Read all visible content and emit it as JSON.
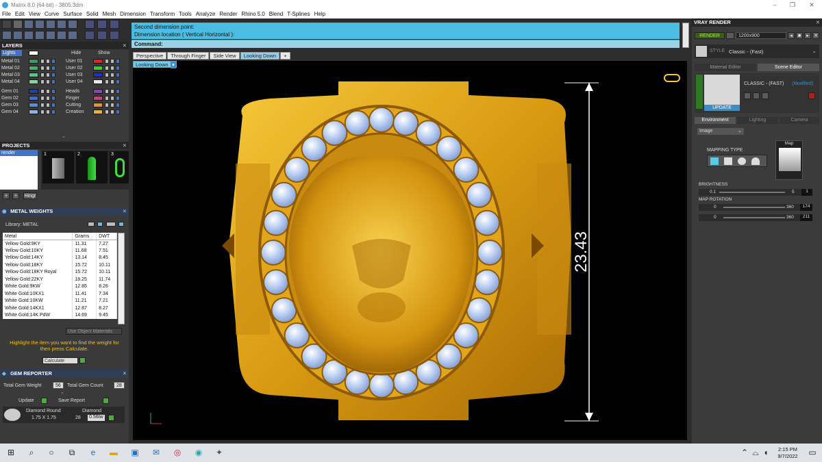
{
  "window": {
    "title": "Matrix 8.0 (64-bit) - 3805.3dm"
  },
  "menu": [
    "File",
    "Edit",
    "View",
    "Curve",
    "Surface",
    "Solid",
    "Mesh",
    "Dimension",
    "Transform",
    "Tools",
    "Analyze",
    "Render",
    "Rhino 5.0",
    "Blend",
    "T-Splines",
    "Help"
  ],
  "layers": {
    "title": "LAYERS",
    "lights_label": "Lights",
    "hide_label": "Hide",
    "show_label": "Show",
    "left": [
      {
        "name": "Metal 01",
        "color": "#2e9e62"
      },
      {
        "name": "Metal 02",
        "color": "#39b86c"
      },
      {
        "name": "Metal 03",
        "color": "#4fc97b"
      },
      {
        "name": "Metal 04",
        "color": "#7bd99a"
      },
      {
        "name": "Gem 01",
        "color": "#1f3fae"
      },
      {
        "name": "Gem 02",
        "color": "#3c6fd6"
      },
      {
        "name": "Gem 03",
        "color": "#5a8de2"
      },
      {
        "name": "Gem 04",
        "color": "#87b0ee"
      }
    ],
    "right": [
      {
        "name": "User 01",
        "color": "#e42222"
      },
      {
        "name": "User 02",
        "color": "#2fcf2f"
      },
      {
        "name": "User 03",
        "color": "#1d2fd6"
      },
      {
        "name": "User 04",
        "color": "#e8e8e8"
      },
      {
        "name": "Heads",
        "color": "#8a3fc0"
      },
      {
        "name": "Finger",
        "color": "#d23c7c"
      },
      {
        "name": "Cutting",
        "color": "#e0962c"
      },
      {
        "name": "Creation",
        "color": "#f0b020"
      }
    ]
  },
  "projects": {
    "title": "PROJECTS",
    "item": "render",
    "thumb_numbers": [
      "1",
      "2",
      "3"
    ],
    "hinge_label": "Hingr"
  },
  "metal_weights": {
    "title": "METAL WEIGHTS",
    "library": "Library: METAL",
    "columns": [
      "Metal",
      "Grams",
      "DWT"
    ],
    "rows": [
      [
        "Yellow Gold:9KY",
        "11.31",
        "7.27"
      ],
      [
        "Yellow Gold:10KY",
        "11.68",
        "7.51"
      ],
      [
        "Yellow Gold:14KY",
        "13.14",
        "8.45"
      ],
      [
        "Yellow Gold:18KY",
        "15.72",
        "10.11"
      ],
      [
        "Yellow Gold:18KY Royal",
        "15.72",
        "10.11"
      ],
      [
        "Yellow Gold:22KY",
        "18.25",
        "11.74"
      ],
      [
        "White Gold:9KW",
        "12.85",
        "8.26"
      ],
      [
        "White Gold:10KX1",
        "11.41",
        "7.34"
      ],
      [
        "White Gold:10KW",
        "11.21",
        "7.21"
      ],
      [
        "White Gold:14KX1",
        "12.87",
        "8.27"
      ],
      [
        "White Gold:14K PdW",
        "14.69",
        "9.45"
      ]
    ],
    "use_object_materials": "Use Object Materials",
    "hint": "Highlight the item you want to find the weight for then press Calculate.",
    "calculate_label": "Calculate"
  },
  "gem_reporter": {
    "title": "GEM REPORTER",
    "total_weight_label": "Total Gem Weight",
    "total_weight": "56",
    "total_count_label": "Total Gem Count",
    "total_count": "28",
    "update_label": "Update",
    "save_label": "Save Report",
    "gem_cut": "Diamond Round",
    "gem_size": "1.75 X 1.75",
    "gem_type": "Diamond",
    "gem_count": "28",
    "gem_weight": "0.56tw"
  },
  "command": {
    "history": [
      "Second dimension point:",
      "Dimension location ( Vertical  Horizontal ):"
    ],
    "label": "Command:"
  },
  "viewport": {
    "tabs": [
      "Perspective",
      "Through Finger",
      "Side View",
      "Looking Down"
    ],
    "active_tab": "Looking Down",
    "add_tab": "+",
    "selected_view": "Looking Down",
    "dimension": "23.43"
  },
  "vray": {
    "title": "VRAY RENDER",
    "render_label": "RENDER",
    "resolution": "1200x900",
    "style_label": "STYLE",
    "style_value": "Classic - (Fast)",
    "material_tab": "Material Editor",
    "scene_tab": "Scene Editor",
    "preset_name": "CLASSIC - (FAST)",
    "preset_status": "(Modified)",
    "update_label": "UPDATE",
    "subtabs": [
      "Environment",
      "Lighting",
      "Camera"
    ],
    "env_type": "Image",
    "mapping_type": "MAPPING TYPE",
    "map_label": "Map",
    "brightness_label": "BRIGHTNESS",
    "brightness_min": "0.1",
    "brightness_max": "5",
    "brightness": "1",
    "rotation_label": "MAP ROTATION",
    "rot1_min": "0",
    "rot1_max": "360",
    "rot1": "174",
    "rot2_min": "0",
    "rot2_max": "360",
    "rot2": "211"
  },
  "taskbar": {
    "time": "2:15 PM",
    "date": "9/7/2022"
  }
}
